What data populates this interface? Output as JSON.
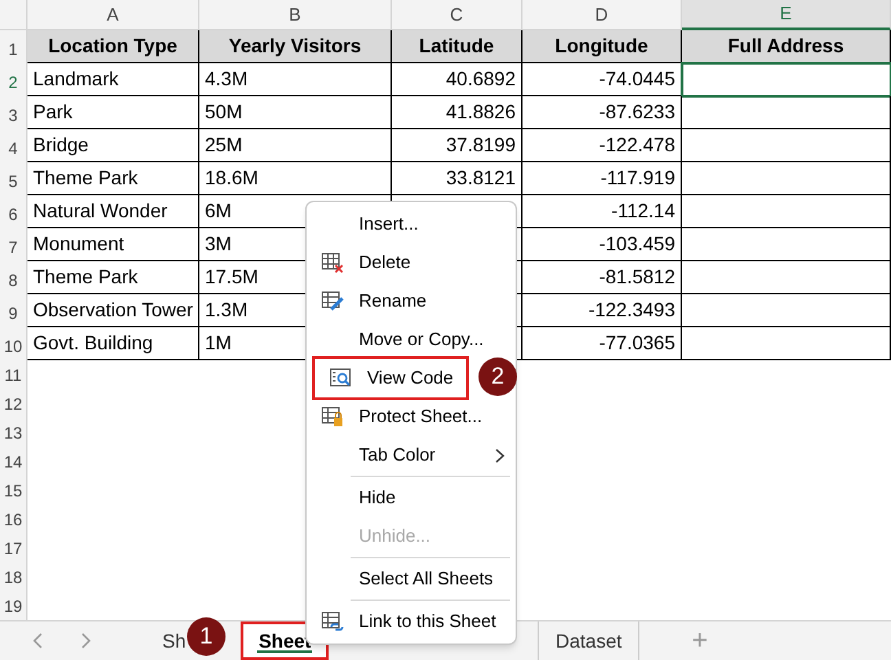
{
  "columns": [
    {
      "label": "A",
      "selected": false
    },
    {
      "label": "B",
      "selected": false
    },
    {
      "label": "C",
      "selected": false
    },
    {
      "label": "D",
      "selected": false
    },
    {
      "label": "E",
      "selected": true
    }
  ],
  "header_row": [
    "Location Type",
    "Yearly Visitors",
    "Latitude",
    "Longitude",
    "Full Address"
  ],
  "rows": [
    {
      "cells": [
        "Landmark",
        "4.3M",
        "40.6892",
        "-74.0445",
        ""
      ],
      "selected": true
    },
    {
      "cells": [
        "Park",
        "50M",
        "41.8826",
        "-87.6233",
        ""
      ],
      "selected": false
    },
    {
      "cells": [
        "Bridge",
        "25M",
        "37.8199",
        "-122.478",
        ""
      ],
      "selected": false
    },
    {
      "cells": [
        "Theme Park",
        "18.6M",
        "33.8121",
        "-117.919",
        ""
      ],
      "selected": false
    },
    {
      "cells": [
        "Natural Wonder",
        "6M",
        "",
        "-112.14",
        ""
      ],
      "selected": false
    },
    {
      "cells": [
        "Monument",
        "3M",
        "",
        "-103.459",
        ""
      ],
      "selected": false
    },
    {
      "cells": [
        "Theme Park",
        "17.5M",
        "",
        "-81.5812",
        ""
      ],
      "selected": false
    },
    {
      "cells": [
        "Observation Tower",
        "1.3M",
        "",
        "-122.3493",
        ""
      ],
      "selected": false
    },
    {
      "cells": [
        "Govt. Building",
        "1M",
        "",
        "-77.0365",
        ""
      ],
      "selected": false
    }
  ],
  "row_numbers": [
    "1",
    "2",
    "3",
    "4",
    "5",
    "6",
    "7",
    "8",
    "9",
    "10",
    "11",
    "12",
    "13",
    "14",
    "15",
    "16",
    "17",
    "18",
    "19"
  ],
  "context_menu": [
    {
      "kind": "plain",
      "label": "Insert...",
      "disabled": false,
      "highlighted": false
    },
    {
      "kind": "delete",
      "label": "Delete",
      "disabled": false,
      "highlighted": false
    },
    {
      "kind": "rename",
      "label": "Rename",
      "disabled": false,
      "highlighted": false
    },
    {
      "kind": "plain",
      "label": "Move or Copy...",
      "disabled": false,
      "highlighted": false
    },
    {
      "kind": "code",
      "label": "View Code",
      "disabled": false,
      "highlighted": true
    },
    {
      "kind": "protect",
      "label": "Protect Sheet...",
      "disabled": false,
      "highlighted": false
    },
    {
      "kind": "plain",
      "label": "Tab Color",
      "disabled": false,
      "highlighted": false,
      "submenu": true
    },
    {
      "kind": "separator"
    },
    {
      "kind": "plain",
      "label": "Hide",
      "disabled": false,
      "highlighted": false
    },
    {
      "kind": "plain",
      "label": "Unhide...",
      "disabled": true,
      "highlighted": false
    },
    {
      "kind": "separator"
    },
    {
      "kind": "plain",
      "label": "Select All Sheets",
      "disabled": false,
      "highlighted": false
    },
    {
      "kind": "separator"
    },
    {
      "kind": "link",
      "label": "Link to this Sheet",
      "disabled": false,
      "highlighted": false
    }
  ],
  "sheet_tabs": [
    {
      "label": "Sh",
      "selected": false
    },
    {
      "label": "Sheet",
      "selected": true,
      "highlighted": true
    },
    {
      "label": "Dataset",
      "selected": false
    }
  ],
  "add_sheet": "+",
  "step_badges": [
    "1",
    "2"
  ]
}
